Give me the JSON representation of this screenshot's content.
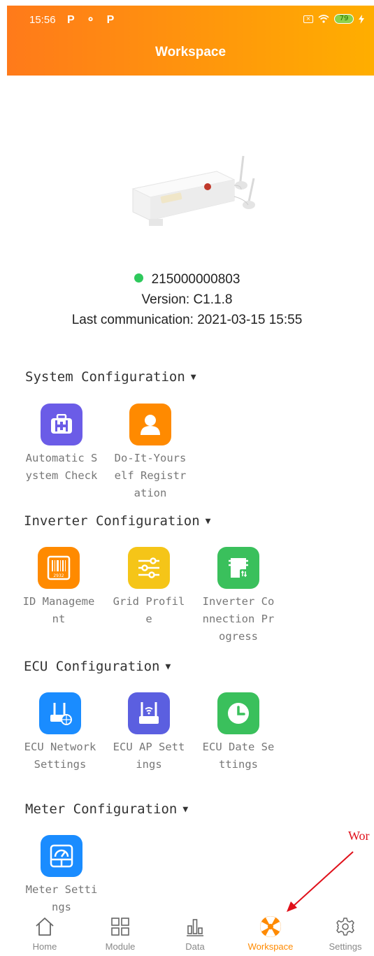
{
  "status_bar": {
    "time": "15:56",
    "left_icons": "P ⚬ P",
    "battery": "79"
  },
  "header": {
    "title": "Workspace"
  },
  "device": {
    "serial": "215000000803",
    "version": "Version: C1.1.8",
    "last_communication": "Last communication: 2021-03-15 15:55",
    "status_color": "#2ec95c"
  },
  "sections": {
    "system": {
      "title": "System Configuration",
      "items": [
        {
          "label": "Automatic System Check",
          "icon": "medical-kit-icon",
          "color": "#6b5ce7"
        },
        {
          "label": "Do-It-Yourself Registration",
          "icon": "person-icon",
          "color": "#ff8a00"
        }
      ]
    },
    "inverter": {
      "title": "Inverter Configuration",
      "items": [
        {
          "label": "ID Management",
          "icon": "barcode-icon",
          "color": "#ff8a00"
        },
        {
          "label": "Grid Profile",
          "icon": "sliders-icon",
          "color": "#f5c518"
        },
        {
          "label": "Inverter Connection Progress",
          "icon": "inverter-icon",
          "color": "#3ac05c"
        }
      ]
    },
    "ecu": {
      "title": "ECU Configuration",
      "items": [
        {
          "label": "ECU Network Settings",
          "icon": "router-network-icon",
          "color": "#1a8cff"
        },
        {
          "label": "ECU AP Settings",
          "icon": "router-wifi-icon",
          "color": "#5b5fe0"
        },
        {
          "label": "ECU Date Settings",
          "icon": "clock-icon",
          "color": "#3ac05c"
        }
      ]
    },
    "meter": {
      "title": "Meter Configuration",
      "items": [
        {
          "label": "Meter Settings",
          "icon": "meter-icon",
          "color": "#1a8cff"
        }
      ]
    }
  },
  "annotation": {
    "text": "Wor"
  },
  "tabbar": {
    "active_color": "#ff8a00",
    "items": [
      {
        "label": "Home",
        "icon": "home-icon"
      },
      {
        "label": "Module",
        "icon": "grid-icon"
      },
      {
        "label": "Data",
        "icon": "bar-chart-icon"
      },
      {
        "label": "Workspace",
        "icon": "workspace-icon"
      },
      {
        "label": "Settings",
        "icon": "gear-icon"
      }
    ]
  }
}
